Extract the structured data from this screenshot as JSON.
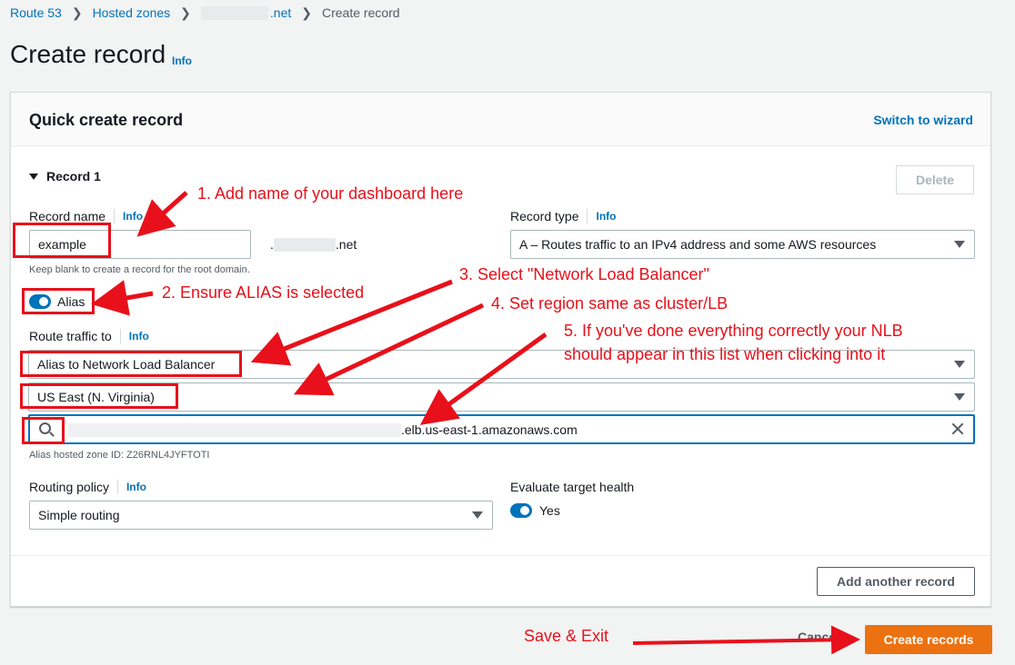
{
  "breadcrumb": {
    "items": [
      "Route 53",
      "Hosted zones",
      ".net",
      "Create record"
    ]
  },
  "page": {
    "title": "Create record",
    "info": "Info"
  },
  "panel": {
    "title": "Quick create record",
    "wizard": "Switch to wizard"
  },
  "record": {
    "header": "Record 1",
    "delete": "Delete",
    "name_label": "Record name",
    "name_info": "Info",
    "name_value": "example",
    "domain_suffix": ".net",
    "name_hint": "Keep blank to create a record for the root domain.",
    "type_label": "Record type",
    "type_info": "Info",
    "type_value": "A – Routes traffic to an IPv4 address and some AWS resources",
    "alias_label": "Alias",
    "route_label": "Route traffic to",
    "route_info": "Info",
    "route_target": "Alias to Network Load Balancer",
    "region": "US East (N. Virginia)",
    "lb_search_value": ".elb.us-east-1.amazonaws.com",
    "zone_hint": "Alias hosted zone ID: Z26RNL4JYFTOTI",
    "policy_label": "Routing policy",
    "policy_info": "Info",
    "policy_value": "Simple routing",
    "health_label": "Evaluate target health",
    "health_value": "Yes"
  },
  "actions": {
    "add_record": "Add another record",
    "cancel": "Cancel",
    "create": "Create records"
  },
  "annotations": {
    "n1": "1. Add name of your dashboard here",
    "n2": "2. Ensure ALIAS is selected",
    "n3": "3. Select \"Network Load Balancer\"",
    "n4": "4. Set region same as cluster/LB",
    "n5a": "5. If you've done everything correctly your NLB",
    "n5b": "should appear in this list when clicking into it",
    "save": "Save & Exit"
  },
  "colors": {
    "link": "#0073bb",
    "primary": "#ec7211",
    "annotation": "#e8101a"
  }
}
